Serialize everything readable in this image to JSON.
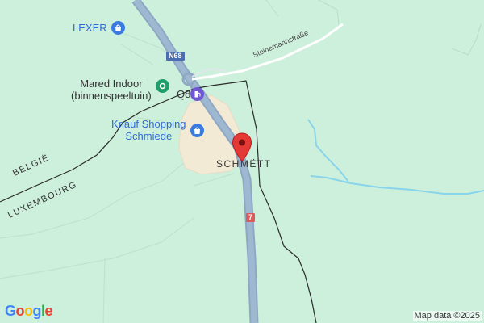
{
  "map": {
    "place_label": "SCHMËTT",
    "street_label": "Steinemannstraße",
    "border_labels": {
      "north": "BELGIË",
      "south": "LUXEMBOURG"
    },
    "road_badges": {
      "n68": "N68",
      "route7": "7"
    },
    "pois": [
      {
        "name": "LEXER",
        "type": "shopping",
        "color": "#3b7be0"
      },
      {
        "name": "Mared Indoor\n(binnenspeeltuin)",
        "type": "leisure",
        "color": "#1e9f6a"
      },
      {
        "name": "Q8",
        "type": "fuel",
        "color": "#6f57d4"
      },
      {
        "name": "Knauf Shopping\nSchmiede",
        "type": "shopping",
        "color": "#3b7be0"
      }
    ],
    "marker": {
      "type": "location-pin",
      "color": "#e53935"
    },
    "logo": "Google",
    "attribution": "Map data ©2025"
  }
}
